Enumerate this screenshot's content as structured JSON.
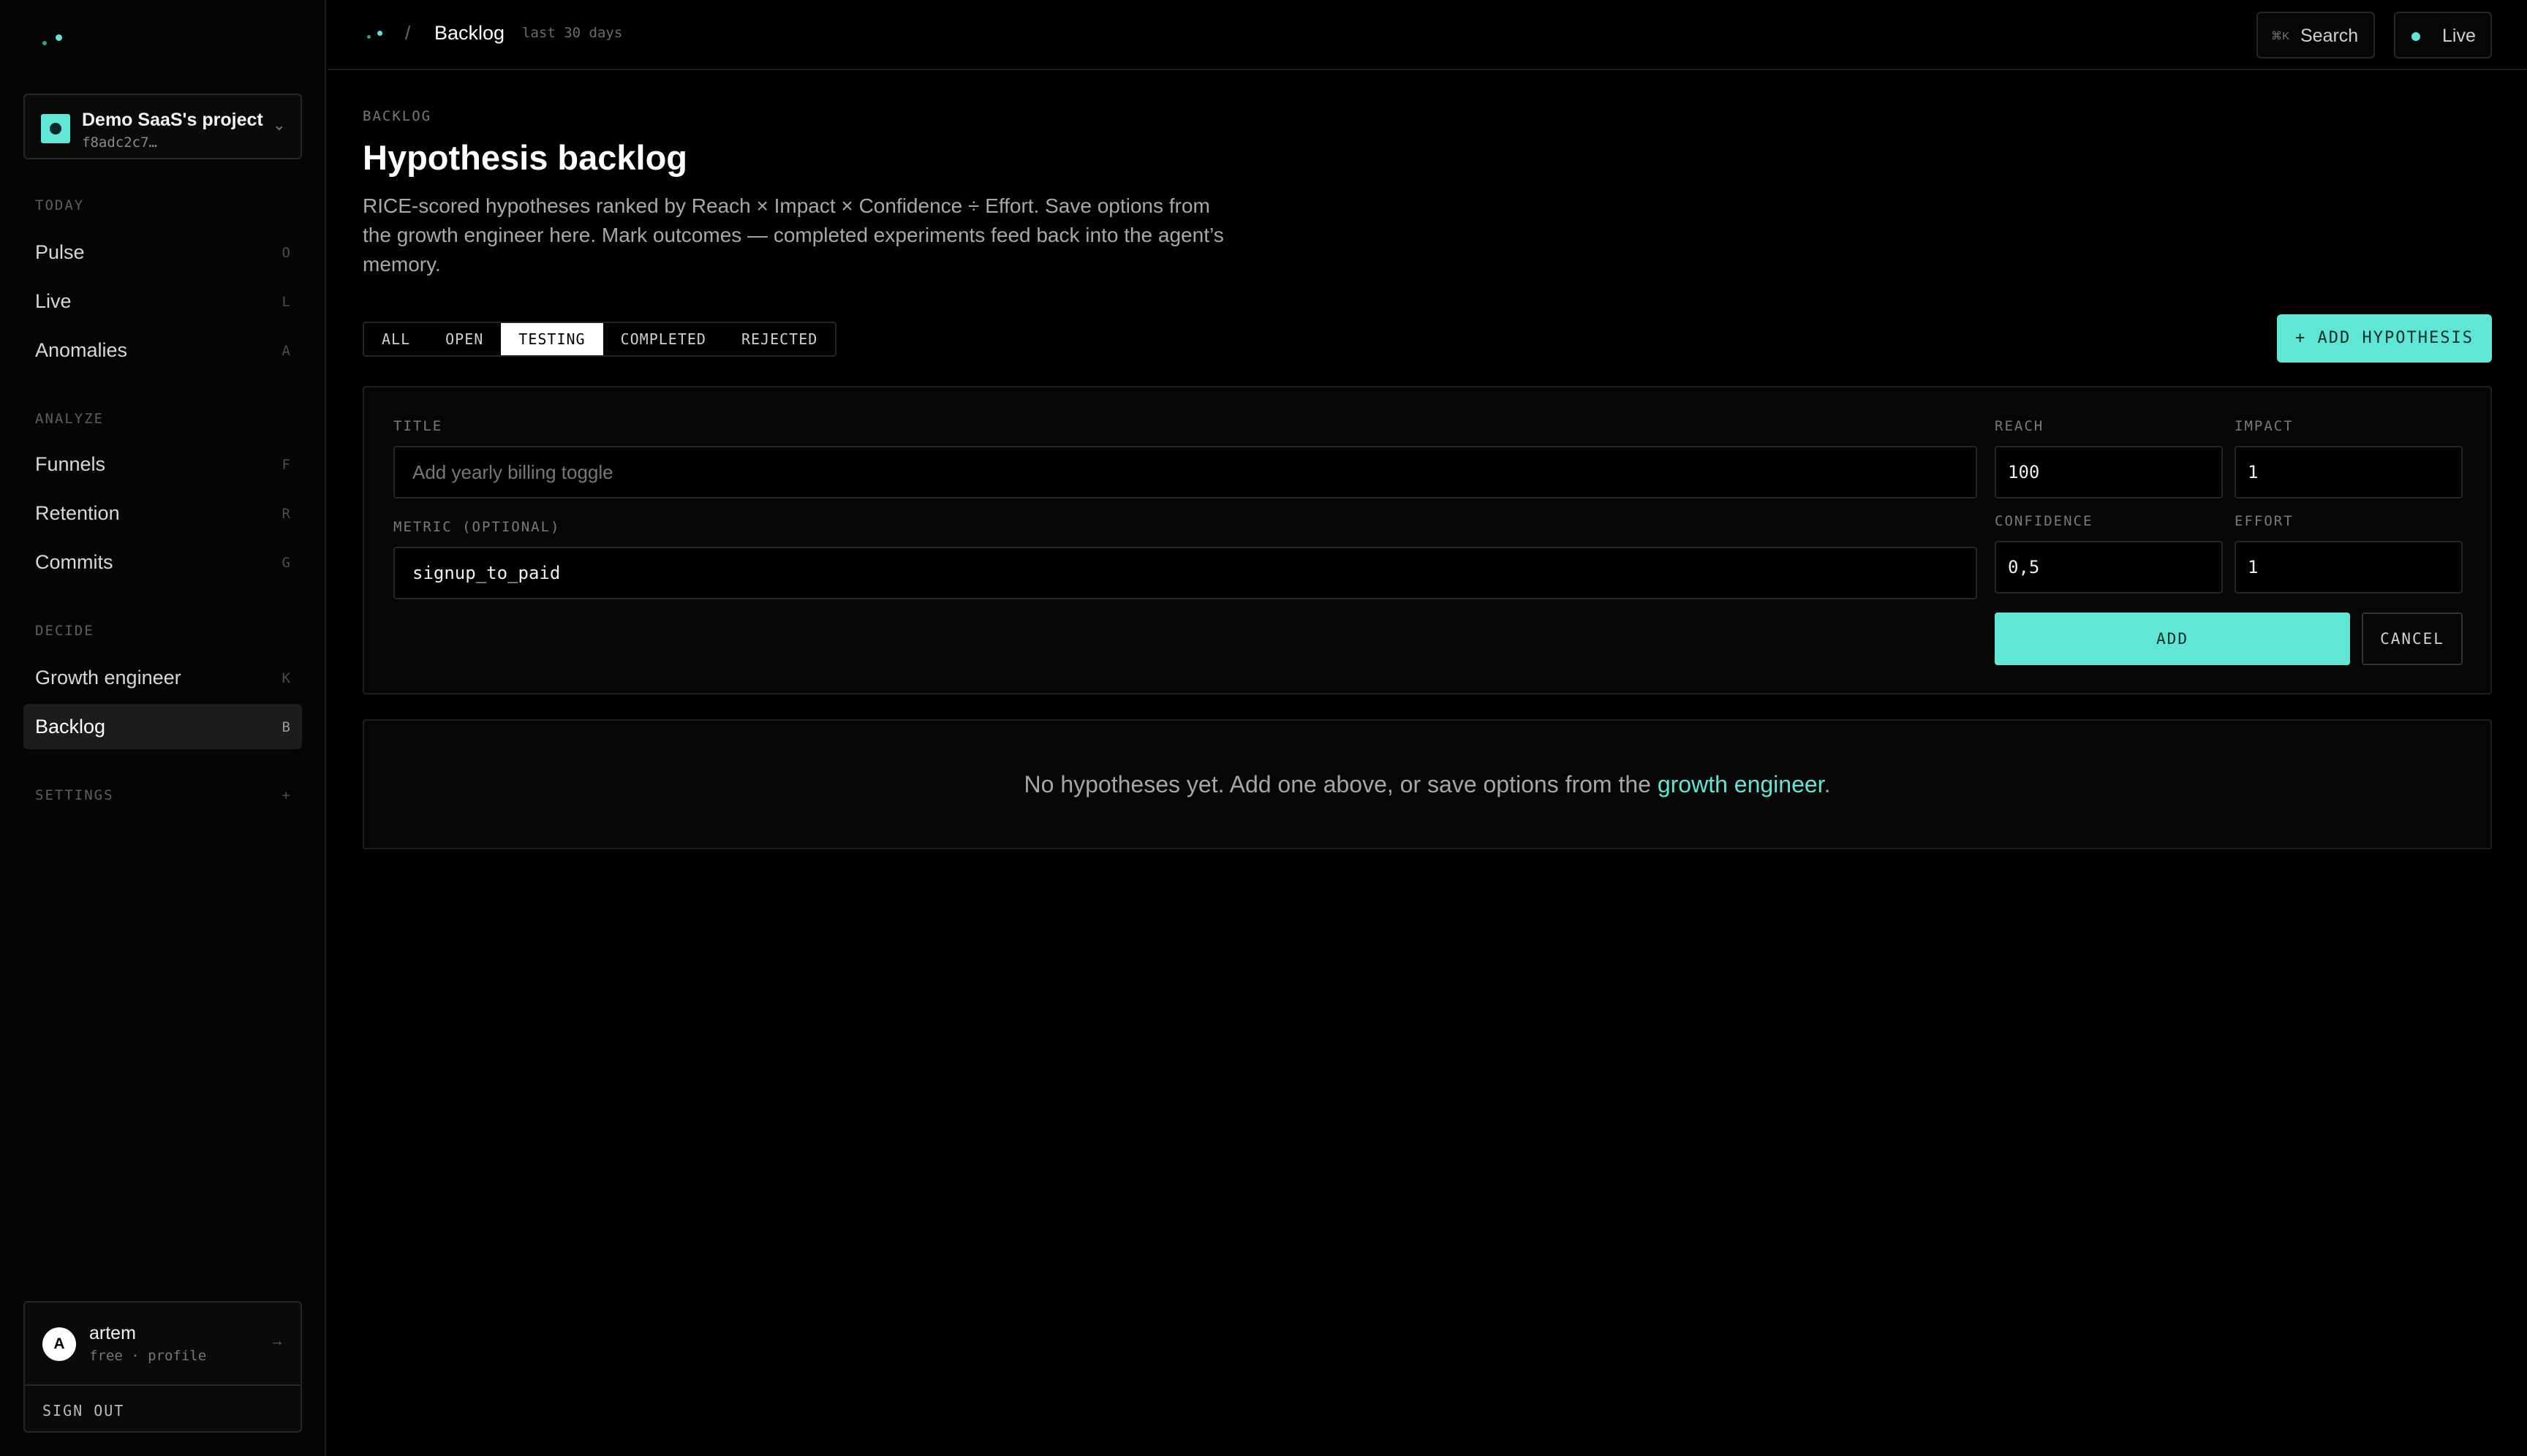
{
  "sidebar": {
    "project": {
      "name": "Demo SaaS's project",
      "id": "f8adc2c7…"
    },
    "sections": {
      "today": "TODAY",
      "analyze": "ANALYZE",
      "decide": "DECIDE",
      "settings": "SETTINGS",
      "settings_key": "+"
    },
    "items": [
      {
        "label": "Pulse",
        "key": "O"
      },
      {
        "label": "Live",
        "key": "L"
      },
      {
        "label": "Anomalies",
        "key": "A"
      },
      {
        "label": "Funnels",
        "key": "F"
      },
      {
        "label": "Retention",
        "key": "R"
      },
      {
        "label": "Commits",
        "key": "G"
      },
      {
        "label": "Growth engineer",
        "key": "K"
      },
      {
        "label": "Backlog",
        "key": "B"
      }
    ],
    "user": {
      "initial": "A",
      "name": "artem",
      "plan": "free · profile",
      "signout": "SIGN OUT"
    }
  },
  "topbar": {
    "breadcrumb_sep": "/",
    "title": "Backlog",
    "range": "last 30 days",
    "search_kbd": "⌘K",
    "search_label": "Search",
    "live_label": "Live"
  },
  "page": {
    "eyebrow": "BACKLOG",
    "title": "Hypothesis backlog",
    "description": "RICE-scored hypotheses ranked by Reach × Impact × Confidence ÷ Effort. Save options from the growth engineer here. Mark outcomes — completed experiments feed back into the agent’s memory.",
    "tabs": [
      "ALL",
      "OPEN",
      "TESTING",
      "COMPLETED",
      "REJECTED"
    ],
    "active_tab": "TESTING",
    "add_button": "+ ADD HYPOTHESIS"
  },
  "form": {
    "title_label": "TITLE",
    "title_placeholder": "Add yearly billing toggle",
    "metric_label": "METRIC (OPTIONAL)",
    "metric_value": "signup_to_paid",
    "reach_label": "REACH",
    "reach_value": "100",
    "impact_label": "IMPACT",
    "impact_value": "1",
    "confidence_label": "CONFIDENCE",
    "confidence_value": "0,5",
    "effort_label": "EFFORT",
    "effort_value": "1",
    "add_label": "ADD",
    "cancel_label": "CANCEL"
  },
  "empty": {
    "text": "No hypotheses yet. Add one above, or save options from the ",
    "link": "growth engineer",
    "end": "."
  },
  "colors": {
    "accent": "#5fe6d4",
    "background": "#000000"
  }
}
